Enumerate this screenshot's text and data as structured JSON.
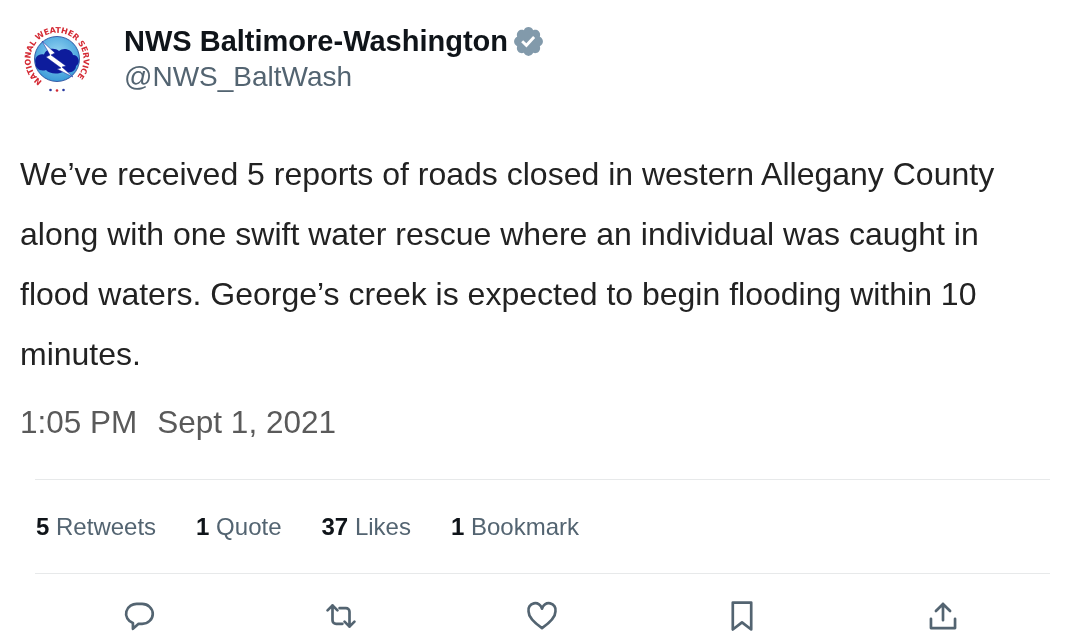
{
  "account": {
    "logo_text": "NATIONAL WEATHER SERVICE",
    "name": "NWS Baltimore-Washington",
    "verified": true,
    "handle": "@NWS_BaltWash"
  },
  "tweet": {
    "text": "We’ve received 5 reports of roads closed in western Allegany County along with one swift water rescue where an individual was caught in flood waters. George’s creek is expected to begin flooding within 10 minutes.",
    "time": "1:05 PM",
    "date": "Sept 1, 2021"
  },
  "stats": [
    {
      "count": "5",
      "label": "Retweets"
    },
    {
      "count": "1",
      "label": "Quote"
    },
    {
      "count": "37",
      "label": "Likes"
    },
    {
      "count": "1",
      "label": "Bookmark"
    }
  ],
  "actions": [
    {
      "kind": "reply"
    },
    {
      "kind": "retweet"
    },
    {
      "kind": "like"
    },
    {
      "kind": "bookmark"
    },
    {
      "kind": "share"
    }
  ]
}
